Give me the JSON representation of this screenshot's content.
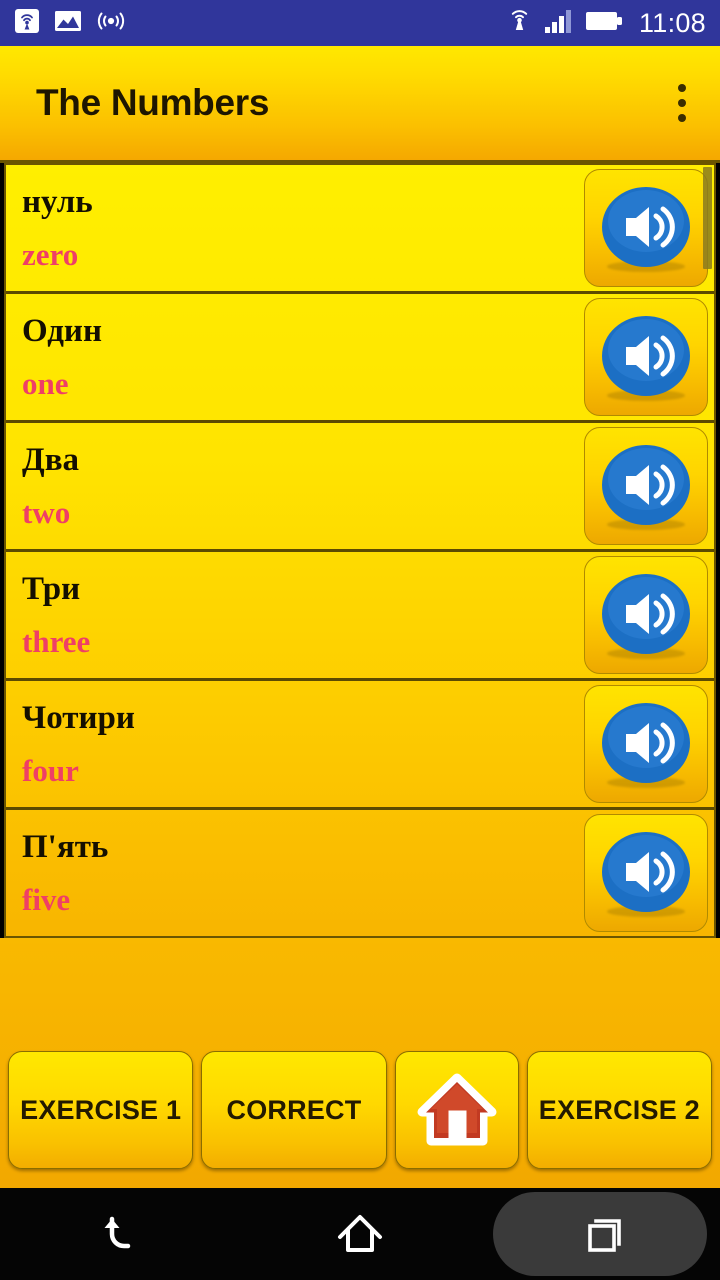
{
  "statusbar": {
    "time": "11:08",
    "left_icons": [
      "cast-screen-icon",
      "image-icon",
      "wireless-broadcast-icon"
    ],
    "right_icons": [
      "nfc-icon",
      "signal-bars-icon",
      "battery-icon"
    ],
    "background_color": "#30369b"
  },
  "titlebar": {
    "title": "The Numbers",
    "overflow_menu": "overflow-menu-icon"
  },
  "list": {
    "scrollbar_visible": true,
    "items": [
      {
        "native": "нуль",
        "translation": "zero",
        "audio_button": "speaker-icon"
      },
      {
        "native": "Один",
        "translation": "one",
        "audio_button": "speaker-icon"
      },
      {
        "native": "Два",
        "translation": "two",
        "audio_button": "speaker-icon"
      },
      {
        "native": "Три",
        "translation": "three",
        "audio_button": "speaker-icon"
      },
      {
        "native": "Чотири",
        "translation": "four",
        "audio_button": "speaker-icon"
      },
      {
        "native": "П'ять",
        "translation": "five",
        "audio_button": "speaker-icon"
      }
    ]
  },
  "bottom_bar": {
    "exercise1_label": "EXERCISE 1",
    "correct_label": "CORRECT",
    "home_icon": "house-icon",
    "exercise2_label": "EXERCISE 2"
  },
  "navbar": {
    "back": "back-arrow-icon",
    "home": "home-outline-icon",
    "recents": "recents-squares-icon"
  },
  "colors": {
    "status_bg": "#30369b",
    "accent_yellow": "#ffe400",
    "accent_orange": "#f5a800",
    "translation_pink": "#ef3f66",
    "native_text": "#140f00",
    "speaker_blue": "#1c6fc4"
  }
}
